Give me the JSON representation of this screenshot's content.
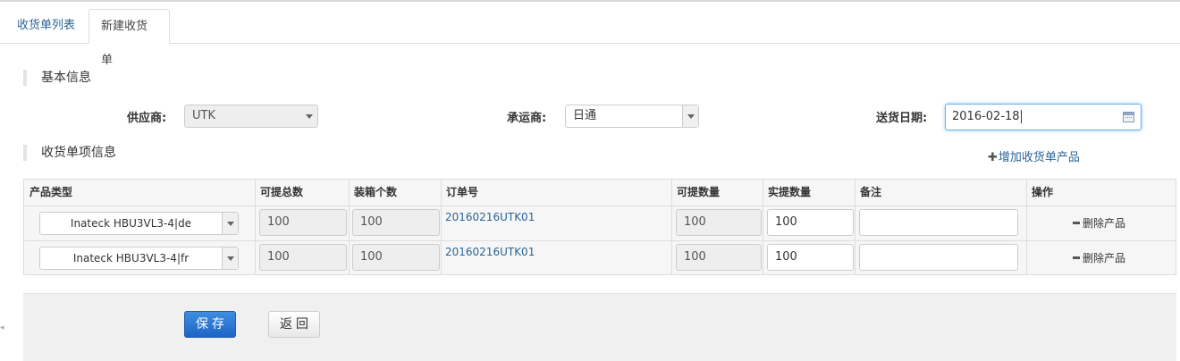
{
  "tabs": [
    {
      "label": "收货单列表"
    },
    {
      "label": "新建收货单"
    }
  ],
  "basic_section": {
    "title": "基本信息"
  },
  "items_section": {
    "title": "收货单项信息",
    "add_label": "增加收货单产品"
  },
  "form": {
    "supplier": {
      "label": "供应商:",
      "value": "UTK"
    },
    "carrier": {
      "label": "承运商:",
      "value": "日通"
    },
    "delivery_date": {
      "label": "送货日期:",
      "value": "2016-02-18"
    }
  },
  "table": {
    "headers": [
      "产品类型",
      "可提总数",
      "装箱个数",
      "订单号",
      "可提数量",
      "实提数量",
      "备注",
      "操作"
    ],
    "rows": [
      {
        "product": "Inateck HBU3VL3-4|de",
        "total": "100",
        "box_count": "100",
        "order_no": "20160216UTK01",
        "available": "100",
        "actual": "100",
        "remark": "",
        "action": "删除产品"
      },
      {
        "product": "Inateck HBU3VL3-4|fr",
        "total": "100",
        "box_count": "100",
        "order_no": "20160216UTK01",
        "available": "100",
        "actual": "100",
        "remark": "",
        "action": "删除产品"
      }
    ]
  },
  "buttons": {
    "save": "保存",
    "back": "返回"
  },
  "icons": {
    "date": "calendar-icon",
    "add": "plus-icon",
    "delete": "minus-icon"
  },
  "colors": {
    "link": "#2a6496",
    "primary": "#1d64c6",
    "focus": "#66afe9"
  }
}
